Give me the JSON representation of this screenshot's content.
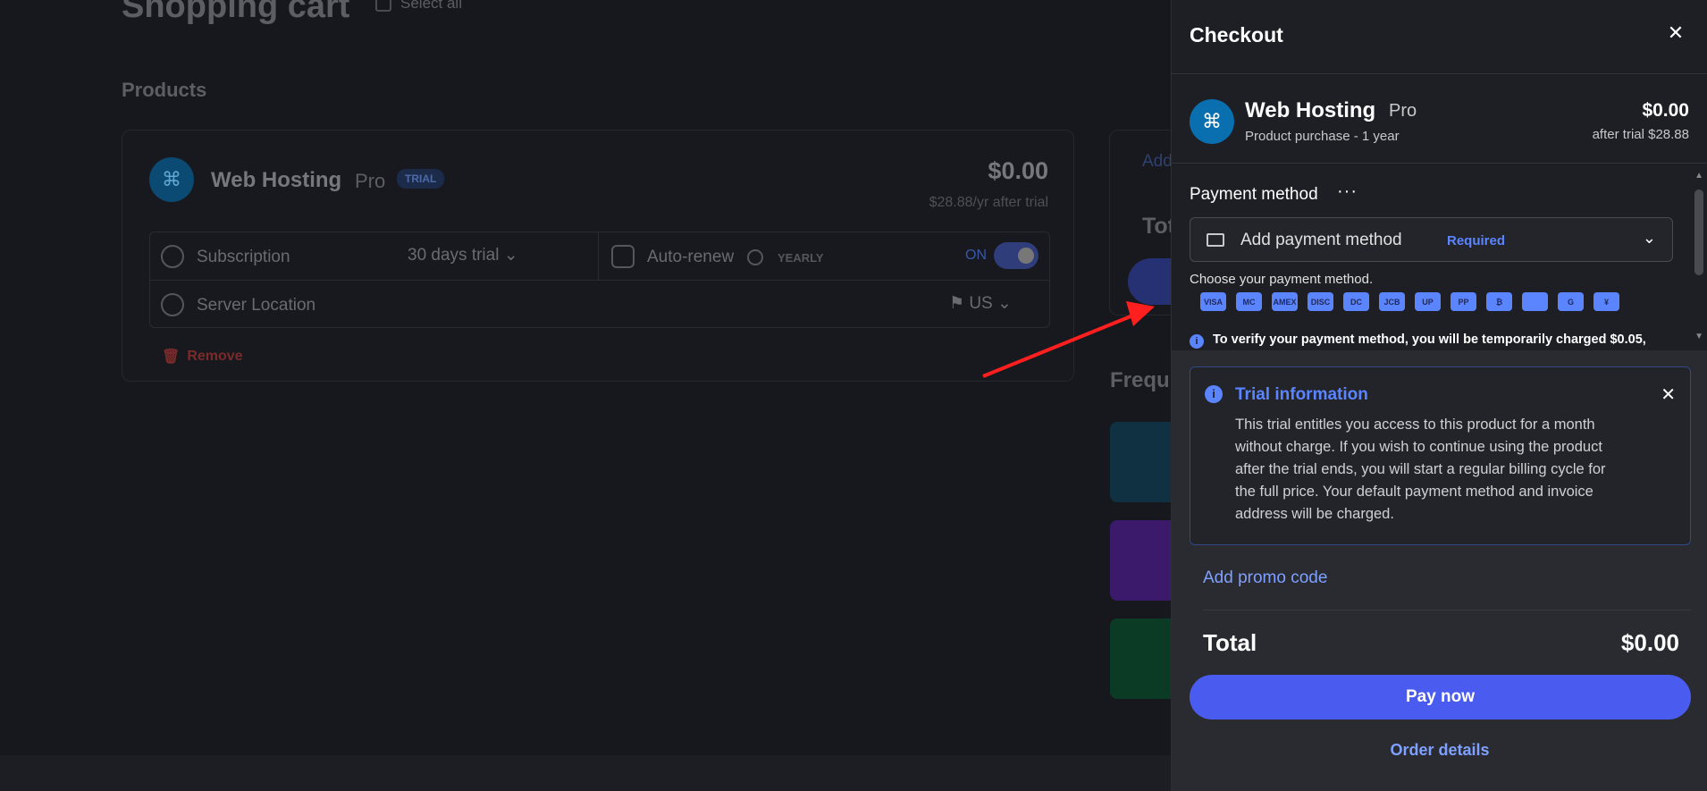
{
  "background": {
    "page_title": "Shopping cart",
    "select_all": "Select all",
    "products_label": "Products",
    "product": {
      "name": "Web Hosting",
      "tier": "Pro",
      "badge": "TRIAL",
      "price": "$0.00",
      "after_trial": "$28.88/yr after trial",
      "subscription_label": "Subscription",
      "subscription_value": "30 days trial",
      "autorenew_label": "Auto-renew",
      "autorenew_period": "YEARLY",
      "autorenew_state": "ON",
      "location_label": "Server Location",
      "location_value": "US",
      "remove_label": "Remove"
    },
    "side": {
      "add_label": "Add",
      "total_label": "Tot"
    },
    "frequent_label": "Frequ"
  },
  "checkout": {
    "title": "Checkout",
    "summary": {
      "name": "Web Hosting",
      "tier": "Pro",
      "subtitle": "Product purchase - 1 year",
      "price": "$0.00",
      "after_trial": "after trial $28.88"
    },
    "payment": {
      "label": "Payment method",
      "more": "···",
      "select_text": "Add payment method",
      "required": "Required",
      "choose_text": "Choose your payment method.",
      "methods": [
        "VISA",
        "MC",
        "AMEX",
        "DISC",
        "DC",
        "JCB",
        "UP",
        "PP",
        "₿",
        "",
        "G",
        "¥"
      ],
      "verify_text": "To verify your payment method, you will be temporarily charged $0.05,"
    },
    "trial_info": {
      "title": "Trial information",
      "body": "This trial entitles you access to this product for a month without charge. If you wish to continue using the product after the trial ends, you will start a regular billing cycle for the full price. Your default payment method and invoice address will be charged."
    },
    "promo_label": "Add promo code",
    "total_label": "Total",
    "total_value": "$0.00",
    "pay_label": "Pay now",
    "order_details": "Order details"
  },
  "colors": {
    "accent": "#4a5cf0",
    "link": "#7ea0ff",
    "info": "#5b84ff"
  }
}
